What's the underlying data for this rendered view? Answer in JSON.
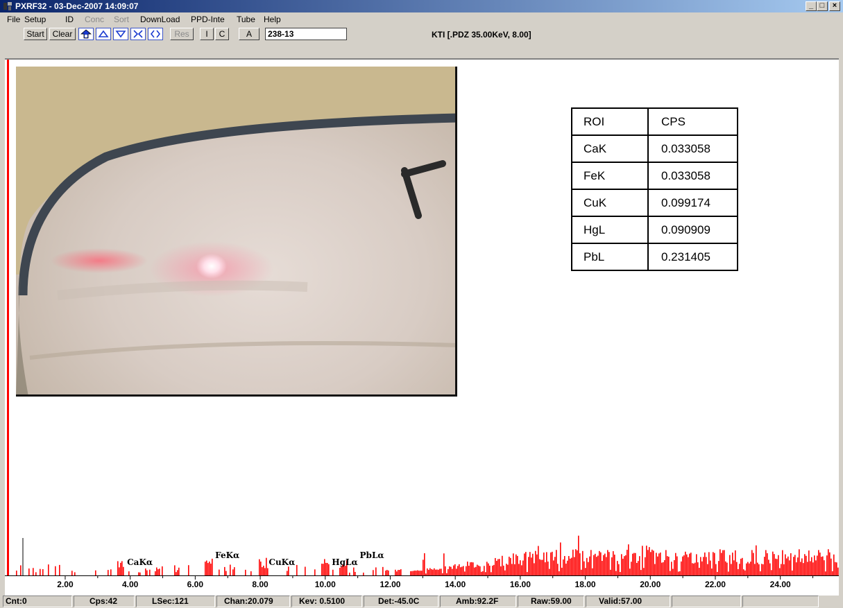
{
  "window": {
    "title": "PXRF32 - 03-Dec-2007 14:09:07",
    "controls": [
      "_",
      "□",
      "×"
    ]
  },
  "menu": [
    {
      "label": "File",
      "enabled": true
    },
    {
      "label": "Setup",
      "enabled": true
    },
    {
      "label": "ID",
      "enabled": true
    },
    {
      "label": "Conc",
      "enabled": false
    },
    {
      "label": "Sort",
      "enabled": false
    },
    {
      "label": "DownLoad",
      "enabled": true
    },
    {
      "label": "PPD-Inte",
      "enabled": true
    },
    {
      "label": "Tube",
      "enabled": true
    },
    {
      "label": "Help",
      "enabled": true
    }
  ],
  "toolbar": {
    "start_label": "Start",
    "clear_label": "Clear",
    "icons": [
      "open-icon",
      "arrow-up-icon",
      "arrow-down-icon",
      "collapse-icon",
      "expand-icon"
    ],
    "res_label": "Res",
    "i_label": "I",
    "c_label": "C",
    "a_label": "A",
    "sample_value": "238-13",
    "status_title": "KTI  [.PDZ 35.00KeV, 8.00]"
  },
  "roi_table": {
    "headers": [
      "ROI",
      "CPS"
    ],
    "rows": [
      [
        "CaK",
        "0.033058"
      ],
      [
        "FeK",
        "0.033058"
      ],
      [
        "CuK",
        "0.099174"
      ],
      [
        "HgL",
        "0.090909"
      ],
      [
        "PbL",
        "0.231405"
      ]
    ]
  },
  "chart_data": {
    "type": "bar",
    "xlabel": "",
    "ylabel": "",
    "xlim": [
      0.4,
      25.8
    ],
    "x_ticks": [
      "2.00",
      "4.00",
      "6.00",
      "8.00",
      "10.00",
      "12.00",
      "14.00",
      "16.00",
      "18.00",
      "20.00",
      "22.00",
      "24.00"
    ],
    "grid": false,
    "peaks": [
      {
        "label": "CaKα",
        "kev": 3.69
      },
      {
        "label": "FeKα",
        "kev": 6.4
      },
      {
        "label": "CuKα",
        "kev": 8.05
      },
      {
        "label": "HgLα",
        "kev": 9.99
      },
      {
        "label": "PbLα",
        "kev": 10.55
      }
    ],
    "series_color": "#ff0000"
  },
  "status": {
    "cnt": "Cnt:0",
    "cps": "Cps:42",
    "lsec": "LSec:121",
    "chan": "Chan:20.079",
    "kev": "Kev: 0.5100",
    "det": "Det:-45.0C",
    "amb": "Amb:92.2F",
    "raw": "Raw:59.00",
    "valid": "Valid:57.00"
  }
}
